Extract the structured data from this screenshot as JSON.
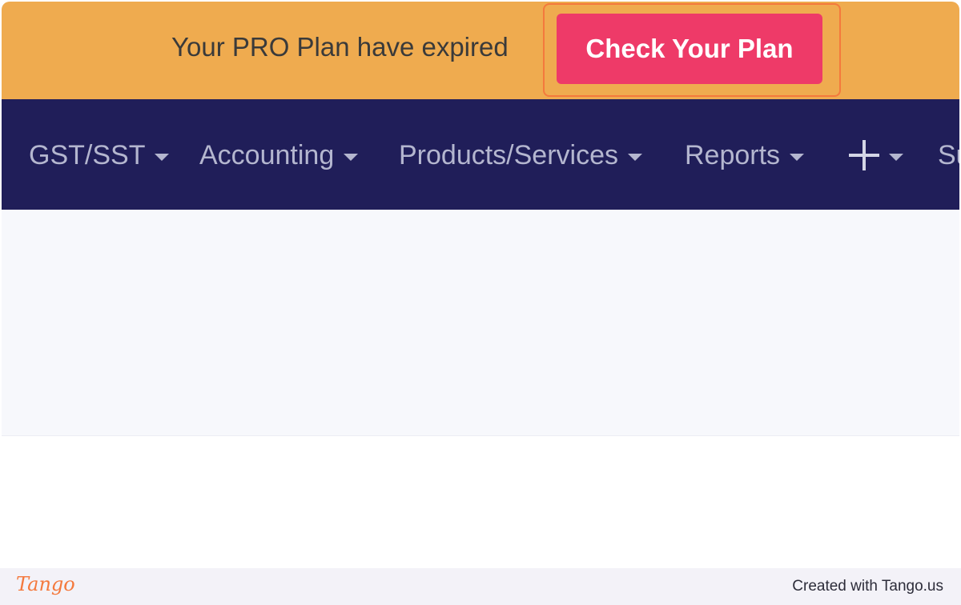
{
  "banner": {
    "message": "Your PRO Plan have expired",
    "cta_label": "Check Your Plan"
  },
  "nav": {
    "items": [
      {
        "label": "GST/SST",
        "icon": "chevron-down-icon"
      },
      {
        "label": "Accounting",
        "icon": "chevron-down-icon"
      },
      {
        "label": "Products/Services",
        "icon": "chevron-down-icon"
      },
      {
        "label": "Reports",
        "icon": "chevron-down-icon"
      },
      {
        "label": "",
        "icon": "plus-icon"
      },
      {
        "label": "Su"
      }
    ]
  },
  "footer": {
    "logo_text": "Tango",
    "credit": "Created with Tango.us"
  },
  "colors": {
    "banner_bg": "#efab4f",
    "cta_bg": "#ee3a68",
    "nav_bg": "#201e59",
    "highlight": "#f4793d"
  }
}
